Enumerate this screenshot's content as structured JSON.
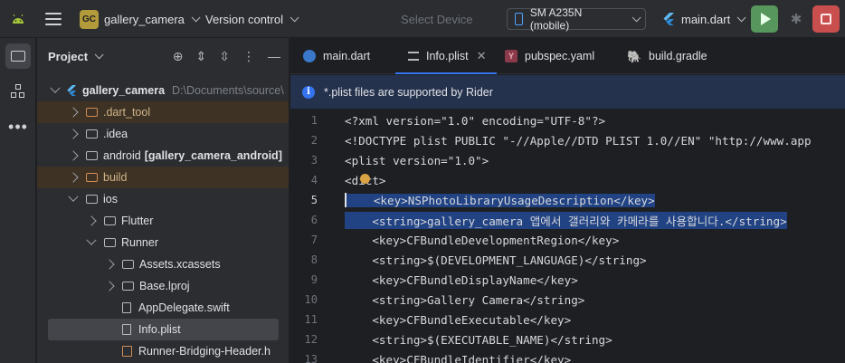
{
  "titlebar": {
    "project_badge": "GC",
    "project_name": "gallery_camera",
    "version_control": "Version control",
    "select_device": "Select Device",
    "device": "SM A235N (mobile)",
    "run_config": "main.dart"
  },
  "project_panel": {
    "title": "Project",
    "tree": [
      {
        "label": "gallery_camera",
        "path": "D:\\Documents\\source\\"
      },
      {
        "label": ".dart_tool"
      },
      {
        "label": ".idea"
      },
      {
        "label": "android",
        "module": "[gallery_camera_android]"
      },
      {
        "label": "build"
      },
      {
        "label": "ios"
      },
      {
        "label": "Flutter"
      },
      {
        "label": "Runner"
      },
      {
        "label": "Assets.xcassets"
      },
      {
        "label": "Base.lproj"
      },
      {
        "label": "AppDelegate.swift"
      },
      {
        "label": "Info.plist"
      },
      {
        "label": "Runner-Bridging-Header.h"
      }
    ]
  },
  "tabs": [
    {
      "label": "main.dart"
    },
    {
      "label": "Info.plist"
    },
    {
      "label": "pubspec.yaml"
    },
    {
      "label": "build.gradle"
    }
  ],
  "banner": {
    "text": "*.plist files are supported by Rider"
  },
  "code": {
    "lines": [
      {
        "num": "1",
        "text": "<?xml version=\"1.0\" encoding=\"UTF-8\"?>"
      },
      {
        "num": "2",
        "text": "<!DOCTYPE plist PUBLIC \"-//Apple//DTD PLIST 1.0//EN\" \"http://www.app"
      },
      {
        "num": "3",
        "text": "<plist version=\"1.0\">"
      },
      {
        "num": "4",
        "text": "<dict>"
      },
      {
        "num": "5",
        "text": "    <key>NSPhotoLibraryUsageDescription</key>"
      },
      {
        "num": "6",
        "text": "    <string>gallery_camera 앱에서 갤러리와 카메라를 사용합니다.</string>"
      },
      {
        "num": "7",
        "text": "    <key>CFBundleDevelopmentRegion</key>"
      },
      {
        "num": "8",
        "text": "    <string>$(DEVELOPMENT_LANGUAGE)</string>"
      },
      {
        "num": "9",
        "text": "    <key>CFBundleDisplayName</key>"
      },
      {
        "num": "10",
        "text": "    <string>Gallery Camera</string>"
      },
      {
        "num": "11",
        "text": "    <key>CFBundleExecutable</key>"
      },
      {
        "num": "12",
        "text": "    <string>$(EXECUTABLE_NAME)</string>"
      },
      {
        "num": "13",
        "text": "    <key>CFBundleIdentifier</key>"
      }
    ]
  },
  "colors": {
    "accent": "#3574f0",
    "run": "#57965c",
    "stop": "#c94f4f",
    "selection": "#214283"
  }
}
